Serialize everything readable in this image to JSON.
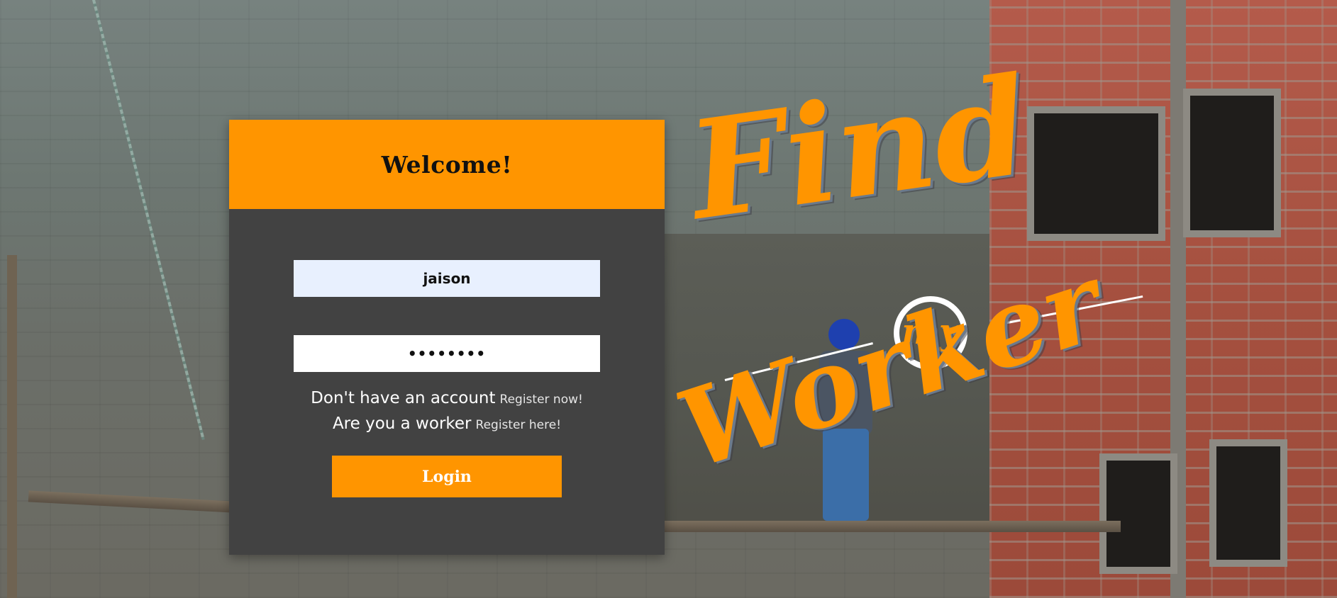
{
  "login": {
    "title": "Welcome!",
    "username_value": "jaison",
    "password_masked": "••••••••",
    "no_account_text": "Don't have an account",
    "register_now_link": "Register now!",
    "worker_text": "Are you a worker",
    "register_here_link": "Register here!",
    "login_button": "Login"
  },
  "logo": {
    "find": "Find",
    "my": "my",
    "worker": "Worker"
  },
  "colors": {
    "accent": "#ff9500",
    "card": "#424242",
    "username_field": "#e8f0fe"
  }
}
